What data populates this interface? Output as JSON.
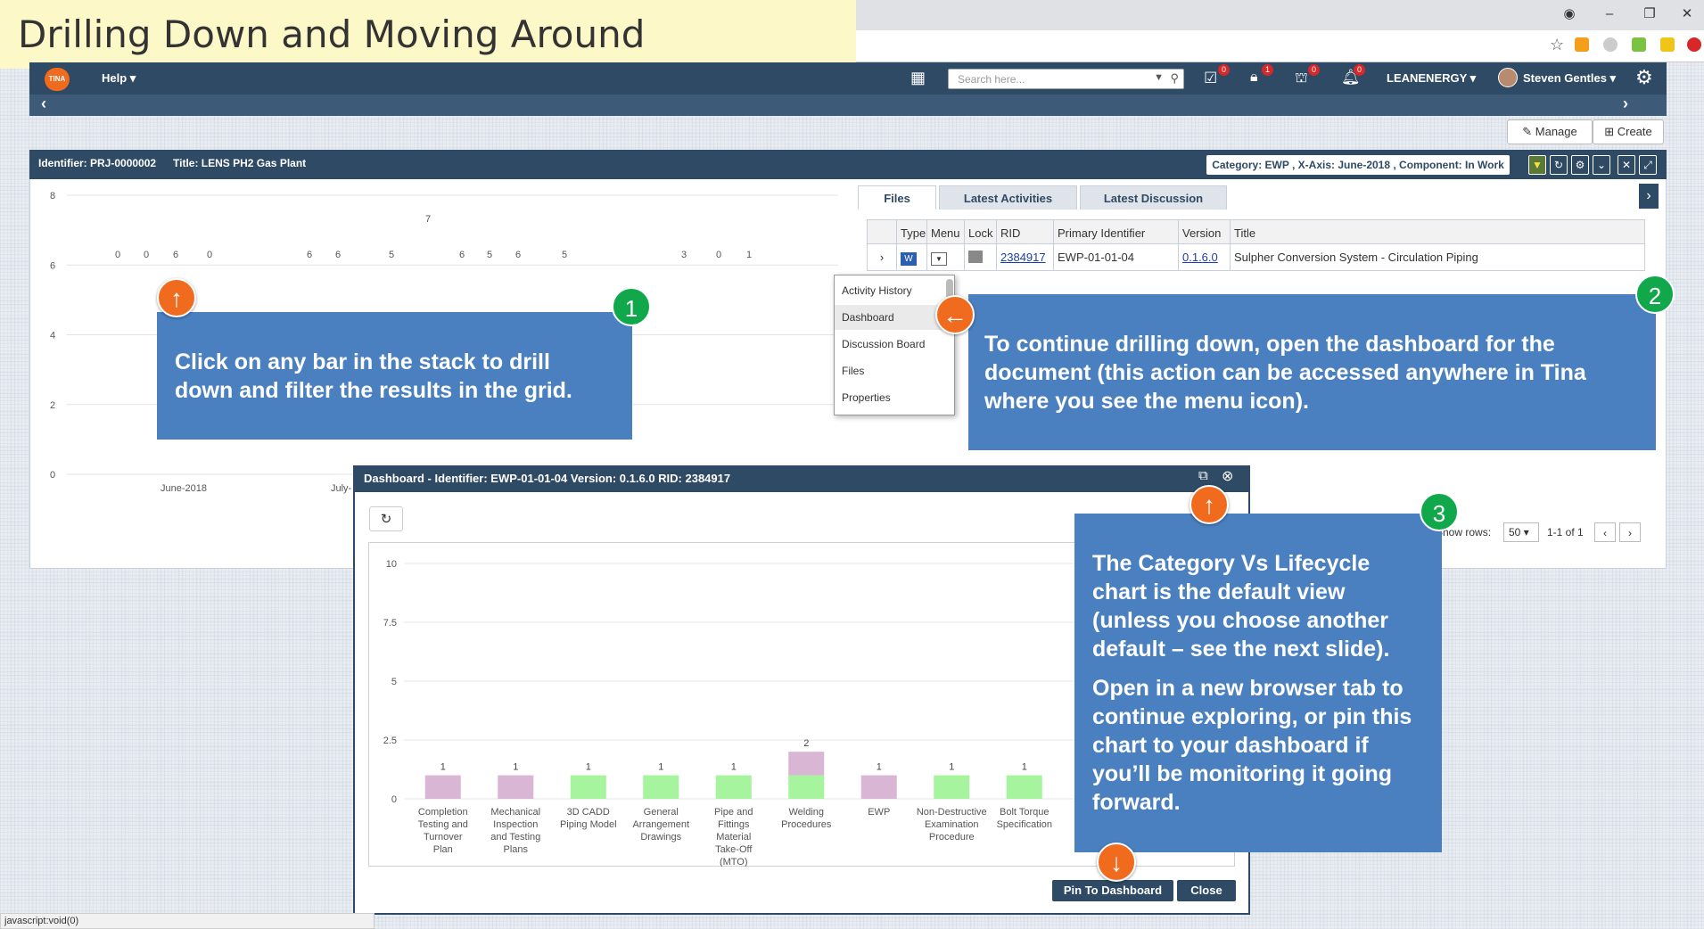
{
  "slide_title": "Drilling Down and Moving Around",
  "status_bar": "javascript:void(0)",
  "nav": {
    "logo": "TINA",
    "help": "Help ▾",
    "search_placeholder": "Search here...",
    "badges": [
      "0",
      "1",
      "0",
      "0"
    ],
    "company": "LEANENERGY ▾",
    "user": "Steven Gentles ▾"
  },
  "toolbar": {
    "manage": "Manage",
    "create": "Create"
  },
  "panel": {
    "identifier": "Identifier: PRJ-0000002",
    "title": "Title: LENS PH2 Gas Plant",
    "filter": "Category: EWP , X-Axis: June-2018 , Component: In Work"
  },
  "main_chart": {
    "y_ticks": [
      "8",
      "6",
      "4",
      "2",
      "0"
    ],
    "x_labels": [
      "June-2018",
      "July-"
    ],
    "bar_labels": [
      "0",
      "0",
      "6",
      "0",
      "6",
      "6",
      "5",
      "7",
      "6",
      "5",
      "6",
      "5",
      "3",
      "0",
      "1"
    ]
  },
  "tabs": [
    "Files",
    "Latest Activities",
    "Latest Discussion"
  ],
  "grid": {
    "headers": [
      "Type",
      "Menu",
      "Lock",
      "RID",
      "Primary Identifier",
      "Version",
      "Title"
    ],
    "row": {
      "rid": "2384917",
      "primary_identifier": "EWP-01-01-04",
      "version": "0.1.6.0",
      "title": "Sulpher Conversion System - Circulation Piping"
    },
    "show_rows_label": "Show rows:",
    "show_rows_value": "50",
    "pager": "1-1 of 1"
  },
  "context_menu": [
    "Activity History",
    "Dashboard",
    "Discussion Board",
    "Files",
    "Properties"
  ],
  "callouts": {
    "c1": "Click on any bar in the stack to drill down and filter the results in the grid.",
    "c2": "To continue drilling down, open the dashboard for the document (this action can be accessed anywhere in Tina where you see the menu icon).",
    "c3a": "The Category Vs Lifecycle chart is the default view (unless you choose another default – see the next slide).",
    "c3b": "Open in a new browser tab to continue exploring, or pin this chart to your  dashboard if you’ll be monitoring it going forward.",
    "n1": "1",
    "n2": "2",
    "n3": "3"
  },
  "dialog": {
    "title": "Dashboard - Identifier: EWP-01-01-04   Version: 0.1.6.0   RID: 2384917",
    "pin": "Pin To Dashboard",
    "close": "Close"
  },
  "chart_data": {
    "type": "bar",
    "title": "",
    "xlabel": "",
    "ylabel": "",
    "ylim": [
      0,
      10
    ],
    "y_ticks": [
      0,
      2.5,
      5,
      7.5,
      10
    ],
    "categories": [
      "Completion Testing and Turnover Plan",
      "Mechanical Inspection and Testing Plans",
      "3D CADD Piping Model",
      "General Arrangement Drawings",
      "Pipe and Fittings Material Take-Off (MTO)",
      "Welding Procedures",
      "EWP",
      "Non-Destructive Examination Procedure",
      "Bolt Torque Specification"
    ],
    "series": [
      {
        "values": [
          0,
          0,
          1,
          1,
          1,
          1,
          0,
          1,
          1
        ],
        "color": "#a6f49e"
      },
      {
        "values": [
          1,
          1,
          0,
          0,
          0,
          1,
          1,
          0,
          0
        ],
        "color": "#d8b6d4"
      }
    ],
    "totals": [
      1,
      1,
      1,
      1,
      1,
      2,
      1,
      1,
      1
    ]
  },
  "colors": {
    "nav": "#2f4a64",
    "callout": "#4a80c0",
    "green": "#10a84a",
    "orange": "#f06b1e",
    "bar_green": "#a6f49e",
    "bar_purple": "#d8b6d4"
  }
}
